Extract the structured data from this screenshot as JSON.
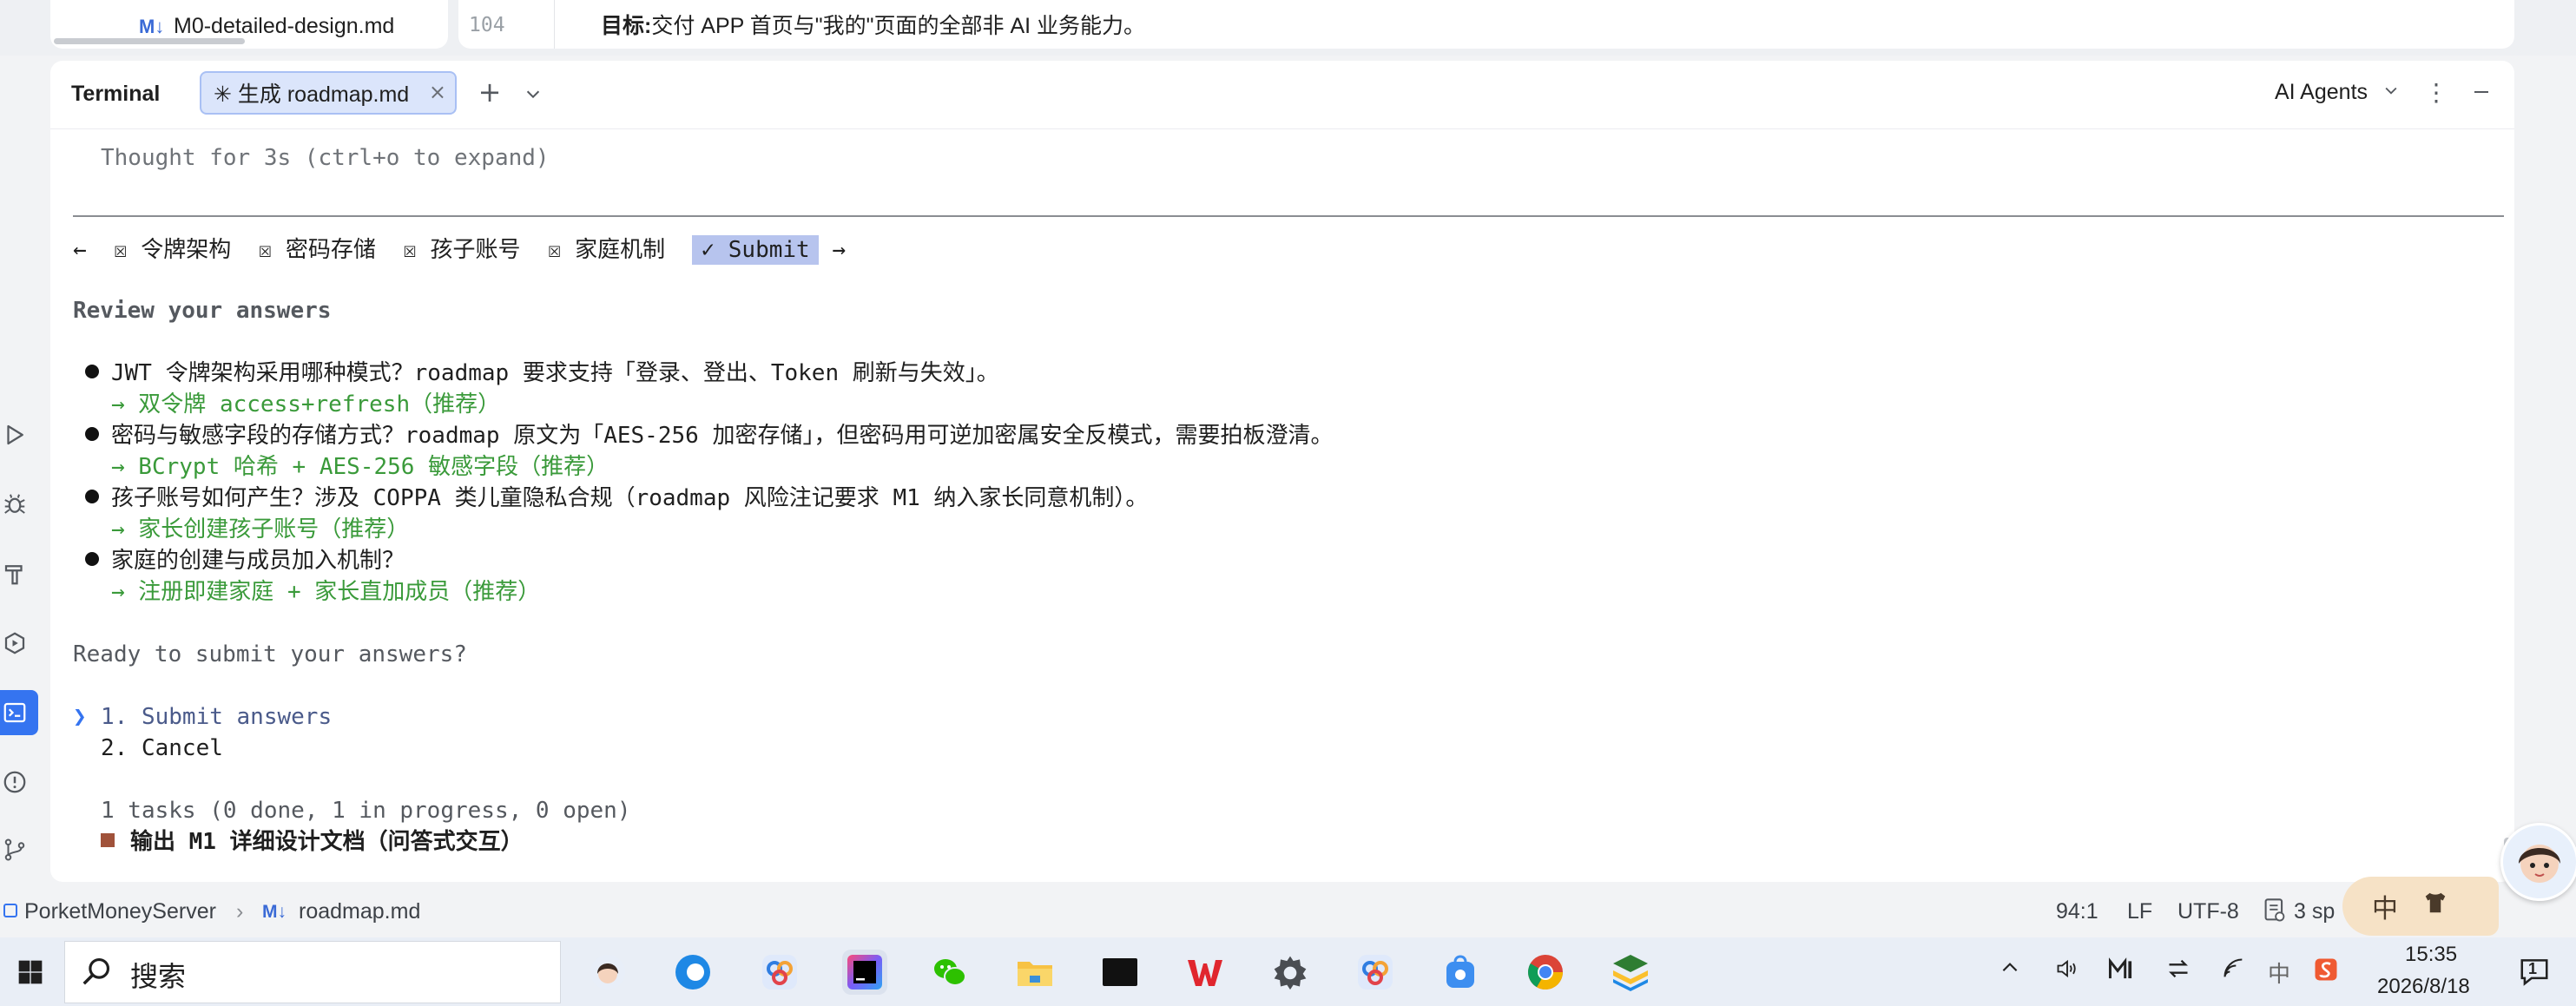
{
  "editor": {
    "file_icon": "M↓",
    "file_name": "M0-detailed-design.md",
    "line_number": "104",
    "line_label": "目标:",
    "line_text": "交付 APP 首页与\"我的\"页面的全部非 AI 业务能力。"
  },
  "terminal": {
    "title": "Terminal",
    "tab_label": "✳ 生成 roadmap.md",
    "tab_close": "×",
    "new_tab": "+",
    "agents_label": "AI Agents",
    "more": "⋮",
    "thought": "Thought for 3s (ctrl+o to expand)",
    "nav": {
      "back": "←",
      "items": [
        "☒ 令牌架构",
        "☒ 密码存储",
        "☒ 孩子账号",
        "☒ 家庭机制"
      ],
      "submit": "✓ Submit",
      "forward": "→"
    },
    "review_heading": "Review your answers",
    "answers": [
      {
        "question": "JWT 令牌架构采用哪种模式？roadmap 要求支持「登录、登出、Token 刷新与失效」。",
        "answer": "→ 双令牌 access+refresh（推荐）"
      },
      {
        "question": "密码与敏感字段的存储方式？roadmap 原文为「AES-256 加密存储」，但密码用可逆加密属安全反模式，需要拍板澄清。",
        "answer": "→ BCrypt 哈希 + AES-256 敏感字段（推荐）"
      },
      {
        "question": "孩子账号如何产生？涉及 COPPA 类儿童隐私合规（roadmap 风险注记要求 M1 纳入家长同意机制）。",
        "answer": "→ 家长创建孩子账号（推荐）"
      },
      {
        "question": "家庭的创建与成员加入机制？",
        "answer": "→ 注册即建家庭 + 家长直加成员（推荐）"
      }
    ],
    "ready_prompt": "Ready to submit your answers?",
    "cursor": "❯",
    "options": [
      "1. Submit answers",
      "2. Cancel"
    ],
    "tasks_summary": "1 tasks (0 done, 1 in progress, 0 open)",
    "task_item": "输出 M1 详细设计文档（问答式交互）"
  },
  "status_bar": {
    "project": "PorketMoneyServer",
    "separator": "›",
    "file_icon": "M↓",
    "file": "roadmap.md",
    "position": "94:1",
    "line_ending": "LF",
    "encoding": "UTF-8",
    "indent": "3 sp"
  },
  "ime": {
    "char": "中"
  },
  "taskbar": {
    "search_placeholder": "搜索",
    "time": "15:35",
    "date": "2026/8/18",
    "tray_ime": "中",
    "notification_count": "1"
  },
  "colors": {
    "accent": "#3574f0",
    "answer_green": "#3a9a3a",
    "submit_highlight": "#b7c4ee",
    "task_marker": "#a0523a"
  }
}
